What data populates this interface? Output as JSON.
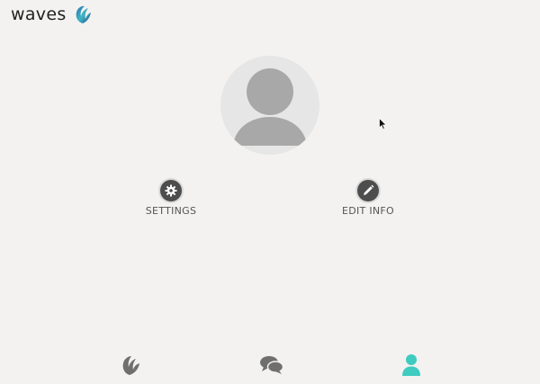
{
  "app": {
    "name": "waves"
  },
  "actions": {
    "settings_label": "SETTINGS",
    "edit_label": "EDIT INFO"
  },
  "nav": {
    "items": [
      {
        "icon": "waves-icon",
        "active": false
      },
      {
        "icon": "chat-bubbles-icon",
        "active": false
      },
      {
        "icon": "user-icon",
        "active": true
      }
    ]
  },
  "colors": {
    "background": "#f3f2f0",
    "accent": "#3fcbc0",
    "icon_inactive": "#6f6f6f",
    "avatar_bg": "#e6e6e6",
    "avatar_fg": "#a8a8a8"
  }
}
